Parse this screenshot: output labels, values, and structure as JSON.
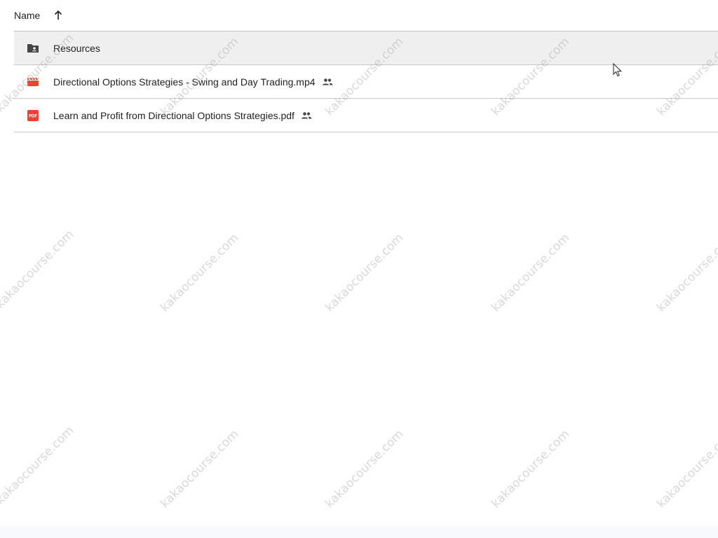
{
  "header": {
    "name_label": "Name",
    "sort_direction": "ascending"
  },
  "files": [
    {
      "name": "Resources",
      "type": "shared-folder",
      "icon": "folder-shared-icon",
      "selected": true,
      "shared": false
    },
    {
      "name": "Directional Options Strategies - Swing and Day Trading.mp4",
      "type": "video",
      "icon": "video-file-icon",
      "selected": false,
      "shared": true
    },
    {
      "name": "Learn and Profit from Directional Options Strategies.pdf",
      "type": "pdf",
      "icon": "pdf-file-icon",
      "selected": false,
      "shared": true
    }
  ],
  "pdf_badge_text": "PDF",
  "watermark_text": "kakaocourse.com",
  "colors": {
    "selected_row": "#efefef",
    "divider": "#c7c7c7",
    "video_icon": "#ea4335",
    "pdf_icon": "#ea4335",
    "folder_icon": "#444746"
  }
}
